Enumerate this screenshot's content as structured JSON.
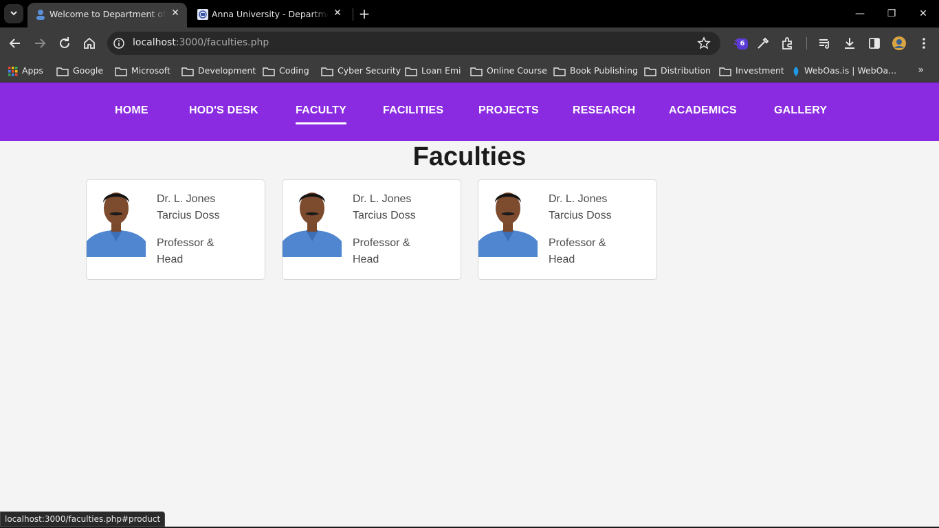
{
  "browser": {
    "tabs": [
      {
        "title": "Welcome to Department of Mathematics",
        "active": true
      },
      {
        "title": "Anna University - Department of",
        "active": false
      }
    ],
    "new_tab": "+",
    "window_controls": {
      "minimize": "—",
      "restore": "❐",
      "close": "✕"
    },
    "address": {
      "host": "localhost",
      "path": ":3000/faculties.php"
    },
    "extension_badge": "6",
    "bookmarks": [
      {
        "label": "Apps",
        "icon": "apps-grid-icon"
      },
      {
        "label": "Google",
        "icon": "folder-icon"
      },
      {
        "label": "Microsoft",
        "icon": "folder-icon"
      },
      {
        "label": "Development",
        "icon": "folder-icon"
      },
      {
        "label": "Coding",
        "icon": "folder-icon"
      },
      {
        "label": "Cyber Security",
        "icon": "folder-icon"
      },
      {
        "label": "Loan Emi",
        "icon": "folder-icon"
      },
      {
        "label": "Online Course",
        "icon": "folder-icon"
      },
      {
        "label": "Book Publishing",
        "icon": "folder-icon"
      },
      {
        "label": "Distribution",
        "icon": "folder-icon"
      },
      {
        "label": "Investment",
        "icon": "folder-icon"
      },
      {
        "label": "WebOas.is | WebOa...",
        "icon": "weboasis-icon"
      }
    ],
    "bookmarks_more": "»",
    "status_url": "localhost:3000/faculties.php#product"
  },
  "nav": {
    "items": [
      "HOME",
      "HOD'S DESK",
      "FACULTY",
      "FACILITIES",
      "PROJECTS",
      "RESEARCH",
      "ACADEMICS",
      "GALLERY"
    ],
    "current": "FACULTY"
  },
  "page": {
    "title": "Faculties",
    "faculty": [
      {
        "name": "Dr. L. Jones Tarcius Doss",
        "designation": "Professor & Head"
      },
      {
        "name": "Dr. L. Jones Tarcius Doss",
        "designation": "Professor & Head"
      },
      {
        "name": "Dr. L. Jones Tarcius Doss",
        "designation": "Professor & Head"
      }
    ]
  },
  "colors": {
    "nav_bg": "#8a2be2",
    "page_bg": "#f4f4f4",
    "chrome_bg": "#3c3c3c",
    "tabstrip_bg": "#000000"
  }
}
